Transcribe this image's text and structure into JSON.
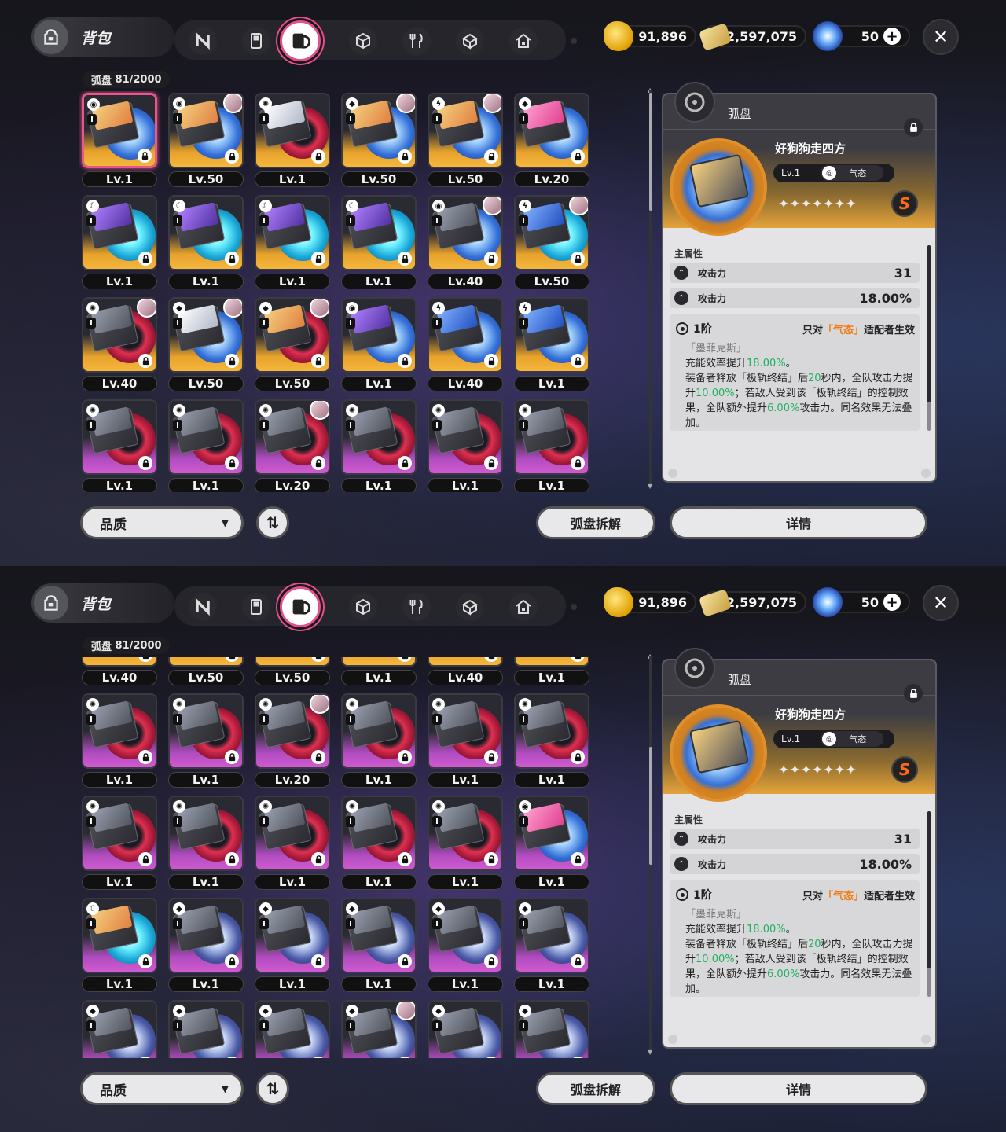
{
  "topbar": {
    "bag_title": "背包",
    "tabs": [
      {
        "name": "n-logo-icon",
        "active": false
      },
      {
        "name": "gameboy-icon",
        "active": false
      },
      {
        "name": "disc-case-icon",
        "active": true
      },
      {
        "name": "cube-icon",
        "active": false
      },
      {
        "name": "fork-knife-icon",
        "active": false
      },
      {
        "name": "box-icon",
        "active": false
      },
      {
        "name": "house-icon",
        "active": false
      }
    ],
    "currencies": [
      {
        "icon": "coin-icon",
        "value": "91,896"
      },
      {
        "icon": "ticket-icon",
        "value": "2,597,075"
      },
      {
        "icon": "gem-icon",
        "value": "50"
      }
    ]
  },
  "section": {
    "label": "弧盘",
    "count": "81/2000"
  },
  "grid": {
    "items": [
      {
        "level": "Lv.1",
        "rarity": "s",
        "disc": "blue",
        "art": "orange",
        "elem": "swirl",
        "avatar": false,
        "selected": true
      },
      {
        "level": "Lv.50",
        "rarity": "s",
        "disc": "blue",
        "art": "orange",
        "elem": "swirl",
        "avatar": true,
        "selected": false
      },
      {
        "level": "Lv.1",
        "rarity": "s",
        "disc": "red",
        "art": "white",
        "elem": "gear",
        "avatar": false,
        "selected": false
      },
      {
        "level": "Lv.50",
        "rarity": "s",
        "disc": "blue",
        "art": "orange",
        "elem": "dice",
        "avatar": true,
        "selected": false
      },
      {
        "level": "Lv.50",
        "rarity": "s",
        "disc": "blue",
        "art": "orange",
        "elem": "bolt",
        "avatar": true,
        "selected": false
      },
      {
        "level": "Lv.20",
        "rarity": "s",
        "disc": "blue",
        "art": "pink",
        "elem": "dice",
        "avatar": false,
        "selected": false
      },
      {
        "level": "Lv.1",
        "rarity": "s",
        "disc": "cyan",
        "art": "purple",
        "elem": "moon",
        "avatar": false,
        "selected": false
      },
      {
        "level": "Lv.1",
        "rarity": "s",
        "disc": "cyan",
        "art": "purple",
        "elem": "moon",
        "avatar": false,
        "selected": false
      },
      {
        "level": "Lv.1",
        "rarity": "s",
        "disc": "cyan",
        "art": "purple",
        "elem": "moon",
        "avatar": false,
        "selected": false
      },
      {
        "level": "Lv.1",
        "rarity": "s",
        "disc": "cyan",
        "art": "purple",
        "elem": "moon",
        "avatar": false,
        "selected": false
      },
      {
        "level": "Lv.40",
        "rarity": "s",
        "disc": "blue",
        "art": "grey",
        "elem": "swirl",
        "avatar": true,
        "selected": false
      },
      {
        "level": "Lv.50",
        "rarity": "s",
        "disc": "cyan",
        "art": "blue",
        "elem": "bolt",
        "avatar": true,
        "selected": false
      },
      {
        "level": "Lv.40",
        "rarity": "s",
        "disc": "red",
        "art": "grey",
        "elem": "gear",
        "avatar": true,
        "selected": false
      },
      {
        "level": "Lv.50",
        "rarity": "s",
        "disc": "blue",
        "art": "white",
        "elem": "dice",
        "avatar": true,
        "selected": false
      },
      {
        "level": "Lv.50",
        "rarity": "s",
        "disc": "red",
        "art": "orange",
        "elem": "dice",
        "avatar": true,
        "selected": false
      },
      {
        "level": "Lv.1",
        "rarity": "s",
        "disc": "blue",
        "art": "purple",
        "elem": "swirl",
        "avatar": false,
        "selected": false
      },
      {
        "level": "Lv.40",
        "rarity": "s",
        "disc": "blue",
        "art": "blue",
        "elem": "bolt",
        "avatar": false,
        "selected": false
      },
      {
        "level": "Lv.1",
        "rarity": "s",
        "disc": "blue",
        "art": "blue",
        "elem": "bolt",
        "avatar": false,
        "selected": false
      },
      {
        "level": "Lv.1",
        "rarity": "a",
        "disc": "red",
        "art": "grey",
        "elem": "gear",
        "avatar": false,
        "selected": false
      },
      {
        "level": "Lv.1",
        "rarity": "a",
        "disc": "red",
        "art": "grey",
        "elem": "gear",
        "avatar": false,
        "selected": false
      },
      {
        "level": "Lv.20",
        "rarity": "a",
        "disc": "red",
        "art": "grey",
        "elem": "gear",
        "avatar": true,
        "selected": false
      },
      {
        "level": "Lv.1",
        "rarity": "a",
        "disc": "red",
        "art": "grey",
        "elem": "gear",
        "avatar": false,
        "selected": false
      },
      {
        "level": "Lv.1",
        "rarity": "a",
        "disc": "red",
        "art": "grey",
        "elem": "gear",
        "avatar": false,
        "selected": false
      },
      {
        "level": "Lv.1",
        "rarity": "a",
        "disc": "red",
        "art": "grey",
        "elem": "gear",
        "avatar": false,
        "selected": false
      },
      {
        "level": "Lv.1",
        "rarity": "a",
        "disc": "red",
        "art": "grey",
        "elem": "gear",
        "avatar": false,
        "selected": false
      },
      {
        "level": "Lv.1",
        "rarity": "a",
        "disc": "red",
        "art": "grey",
        "elem": "gear",
        "avatar": false,
        "selected": false
      },
      {
        "level": "Lv.1",
        "rarity": "a",
        "disc": "red",
        "art": "grey",
        "elem": "gear",
        "avatar": false,
        "selected": false
      },
      {
        "level": "Lv.1",
        "rarity": "a",
        "disc": "red",
        "art": "grey",
        "elem": "gear",
        "avatar": false,
        "selected": false
      },
      {
        "level": "Lv.1",
        "rarity": "a",
        "disc": "red",
        "art": "grey",
        "elem": "gear",
        "avatar": false,
        "selected": false
      },
      {
        "level": "Lv.1",
        "rarity": "a",
        "disc": "blue",
        "art": "pink",
        "elem": "swirl",
        "avatar": false,
        "selected": false
      },
      {
        "level": "Lv.1",
        "rarity": "a",
        "disc": "cyan",
        "art": "orange",
        "elem": "moon",
        "avatar": false,
        "selected": false
      },
      {
        "level": "Lv.1",
        "rarity": "a",
        "disc": "dark",
        "art": "grey",
        "elem": "dice",
        "avatar": false,
        "selected": false
      },
      {
        "level": "Lv.1",
        "rarity": "a",
        "disc": "dark",
        "art": "grey",
        "elem": "dice",
        "avatar": false,
        "selected": false
      },
      {
        "level": "Lv.1",
        "rarity": "a",
        "disc": "dark",
        "art": "grey",
        "elem": "dice",
        "avatar": false,
        "selected": false
      },
      {
        "level": "Lv.1",
        "rarity": "a",
        "disc": "dark",
        "art": "grey",
        "elem": "dice",
        "avatar": false,
        "selected": false
      },
      {
        "level": "Lv.1",
        "rarity": "a",
        "disc": "dark",
        "art": "grey",
        "elem": "dice",
        "avatar": false,
        "selected": false
      },
      {
        "level": "",
        "rarity": "a",
        "disc": "dark",
        "art": "grey",
        "elem": "dice",
        "avatar": false,
        "selected": false
      },
      {
        "level": "",
        "rarity": "a",
        "disc": "dark",
        "art": "grey",
        "elem": "dice",
        "avatar": false,
        "selected": false
      },
      {
        "level": "",
        "rarity": "a",
        "disc": "dark",
        "art": "grey",
        "elem": "dice",
        "avatar": false,
        "selected": false
      },
      {
        "level": "",
        "rarity": "a",
        "disc": "dark",
        "art": "grey",
        "elem": "dice",
        "avatar": true,
        "selected": false
      },
      {
        "level": "",
        "rarity": "a",
        "disc": "dark",
        "art": "grey",
        "elem": "dice",
        "avatar": false,
        "selected": false
      },
      {
        "level": "",
        "rarity": "a",
        "disc": "dark",
        "art": "grey",
        "elem": "dice",
        "avatar": false,
        "selected": false
      }
    ]
  },
  "detail": {
    "type_label": "弧盘",
    "name": "好狗狗走四方",
    "level": "Lv.1",
    "attribute": "气态",
    "stars": "✦✦✦✦✦✦✦",
    "rank": "S",
    "main_attr_title": "主属性",
    "stats": [
      {
        "name": "攻击力",
        "value": "31"
      },
      {
        "name": "攻击力",
        "value": "18.00%"
      }
    ],
    "tier_label": "1阶",
    "condition_prefix": "只对",
    "condition_attr": "「气态」",
    "condition_suffix": "适配者生效",
    "set_name": "「墨菲克斯」",
    "effect_parts": [
      {
        "t": "充能效率提升",
        "g": false
      },
      {
        "t": "18.00%",
        "g": true
      },
      {
        "t": "。",
        "g": false
      },
      {
        "t": "装备者释放「极轨终结」后",
        "g": false
      },
      {
        "t": "20",
        "g": true
      },
      {
        "t": "秒内，全队攻击力提升",
        "g": false
      },
      {
        "t": "10.00%",
        "g": true
      },
      {
        "t": "；若敌人受到该「极轨终结」的控制效果，全队额外提升",
        "g": false
      },
      {
        "t": "6.00%",
        "g": true
      },
      {
        "t": "攻击力。同名效果无法叠加。",
        "g": false
      }
    ]
  },
  "bottom": {
    "quality_label": "品质",
    "dismantle_label": "弧盘拆解",
    "details_label": "详情",
    "sort_symbol": "⇅"
  }
}
